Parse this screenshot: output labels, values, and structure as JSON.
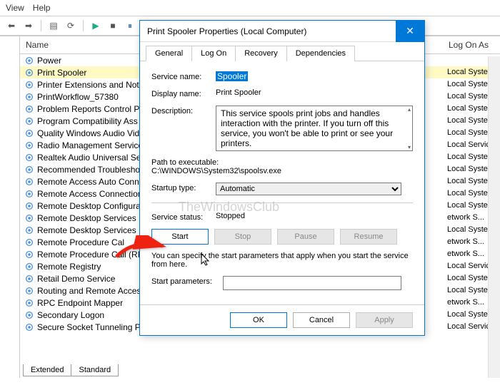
{
  "menu": {
    "view": "View",
    "help": "Help"
  },
  "list_header": {
    "name": "Name",
    "logon": "Log On As"
  },
  "services": [
    {
      "n": "Power",
      "r": ""
    },
    {
      "n": "Print Spooler",
      "r": "Local Syste..."
    },
    {
      "n": "Printer Extensions and Not",
      "r": "Local Syste..."
    },
    {
      "n": "PrintWorkflow_57380",
      "r": "Local Syste..."
    },
    {
      "n": "Problem Reports Control P",
      "r": "Local Syste..."
    },
    {
      "n": "Program Compatibility Ass",
      "r": "Local Syste..."
    },
    {
      "n": "Quality Windows Audio Vide",
      "r": "Local Syste..."
    },
    {
      "n": "Radio Management Service",
      "r": "Local Service"
    },
    {
      "n": "Realtek Audio Universal Se",
      "r": "Local Syste..."
    },
    {
      "n": "Recommended Troubleshoo",
      "r": "Local Syste..."
    },
    {
      "n": "Remote Access Auto Conn",
      "r": "Local Syste..."
    },
    {
      "n": "Remote Access Connection",
      "r": "Local Syste..."
    },
    {
      "n": "Remote Desktop Configura",
      "r": "Local Syste..."
    },
    {
      "n": "Remote Desktop Services",
      "r": "etwork S..."
    },
    {
      "n": "Remote Desktop Services I",
      "r": "Local Syste..."
    },
    {
      "n": "Remote Procedure Cal",
      "r": "etwork S..."
    },
    {
      "n": "Remote Procedure Call (RP",
      "r": "etwork S..."
    },
    {
      "n": "Remote Registry",
      "r": "Local Service"
    },
    {
      "n": "Retail Demo Service",
      "r": "Local Syste..."
    },
    {
      "n": "Routing and Remote Acces",
      "r": "Local Syste..."
    },
    {
      "n": "RPC Endpoint Mapper",
      "r": "etwork S..."
    },
    {
      "n": "Secondary Logon",
      "r": "Local Syste..."
    },
    {
      "n": "Secure Socket Tunneling Protocol Service",
      "r": "Local Service"
    }
  ],
  "tabs": {
    "ext": "Extended",
    "std": "Standard"
  },
  "dialog": {
    "title": "Print Spooler Properties (Local Computer)",
    "tabs": {
      "general": "General",
      "logon": "Log On",
      "recovery": "Recovery",
      "deps": "Dependencies"
    },
    "service_name_l": "Service name:",
    "service_name": "Spooler",
    "display_l": "Display name:",
    "display": "Print Spooler",
    "desc_l": "Description:",
    "desc": "This service spools print jobs and handles interaction with the printer.  If you turn off this service, you won't be able to print or see your printers.",
    "path_l": "Path to executable:",
    "path": "C:\\WINDOWS\\System32\\spoolsv.exe",
    "startup_l": "Startup type:",
    "startup": "Automatic",
    "status_l": "Service status:",
    "status": "Stopped",
    "btn_start": "Start",
    "btn_stop": "Stop",
    "btn_pause": "Pause",
    "btn_resume": "Resume",
    "note": "You can specify the start parameters that apply when you start the service from here.",
    "params_l": "Start parameters:",
    "ok": "OK",
    "cancel": "Cancel",
    "apply": "Apply"
  },
  "watermark": "TheWindowsClub"
}
